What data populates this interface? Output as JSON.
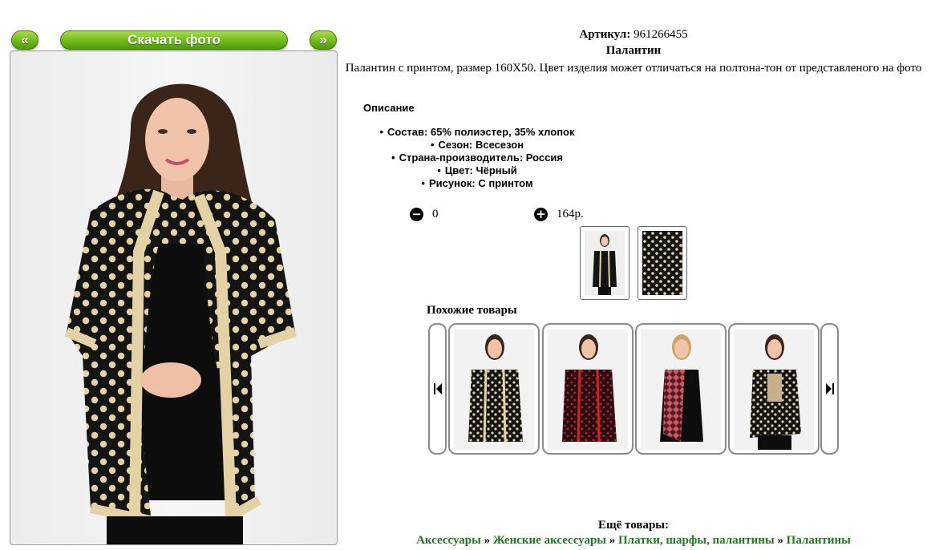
{
  "gallery": {
    "prev_label": "«",
    "download_label": "Скачать фото",
    "next_label": "»"
  },
  "product": {
    "sku_label": "Артикул:",
    "sku_value": "961266455",
    "name": "Палантин",
    "description": "Палантин с принтом, размер 160Х50. Цвет изделия может отличаться на полтона-тон от представленого на фото",
    "description_title": "Описание",
    "properties": [
      "Состав: 65% полиэстер, 35% хлопок",
      "Сезон: Всесезон",
      "Страна-производитель: Россия",
      "Цвет: Чёрный",
      "Рисунок: С принтом"
    ],
    "quantity": "0",
    "price": "164р.",
    "minus_icon": "minus-circle-icon",
    "plus_icon": "plus-circle-icon"
  },
  "similar": {
    "title": "Похожие товары",
    "items": [
      {
        "icon": "product-photo"
      },
      {
        "icon": "product-photo"
      },
      {
        "icon": "product-photo"
      },
      {
        "icon": "product-photo"
      }
    ]
  },
  "more": {
    "title": "Ещё товары:",
    "crumbs": [
      "Аксессуары",
      "Женские аксессуары",
      "Платки, шарфы, палантины",
      "Палантины"
    ],
    "separator": "»"
  },
  "colors": {
    "button_green": "#78c01f",
    "link_green": "#1f7a1f",
    "scarf_black": "#141414",
    "scarf_beige": "#e2d2a6"
  }
}
